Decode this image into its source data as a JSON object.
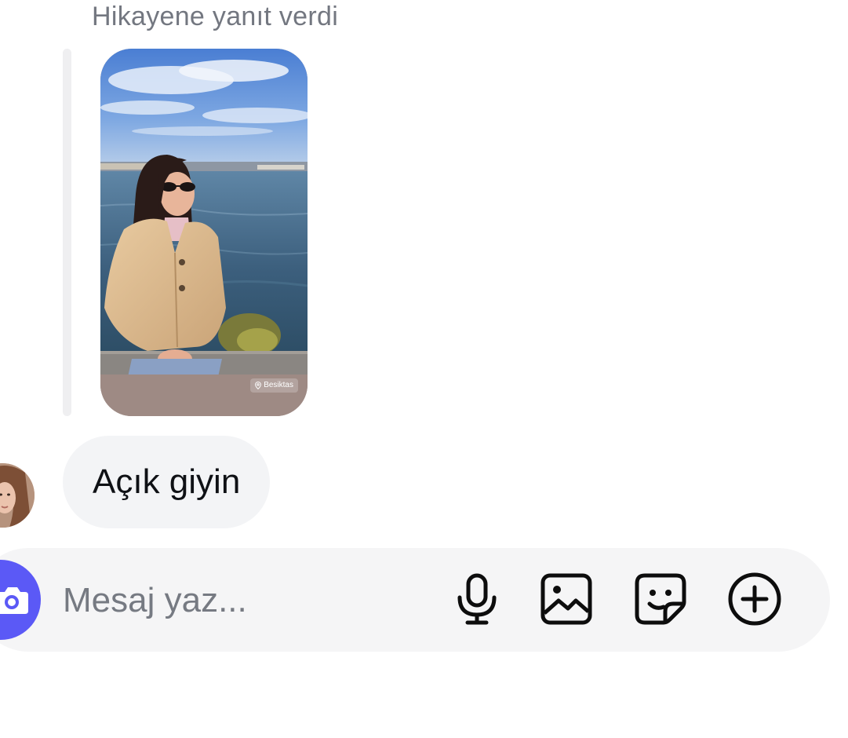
{
  "reply": {
    "caption": "Hikayene yanıt verdi",
    "story": {
      "location": "Besiktas",
      "location_icon": "location-pin-icon",
      "image_description_icon": "story-photo"
    }
  },
  "message": {
    "text": "Açık giyin",
    "avatar_icon": "user-avatar"
  },
  "composer": {
    "placeholder": "Mesaj yaz...",
    "camera_icon": "camera-icon",
    "mic_icon": "microphone-icon",
    "gallery_icon": "gallery-icon",
    "sticker_icon": "sticker-icon",
    "more_icon": "plus-circle-icon"
  },
  "colors": {
    "accent": "#5b59f6",
    "bubble": "#f3f4f6",
    "composer": "#f5f5f6",
    "caption": "#737780"
  }
}
